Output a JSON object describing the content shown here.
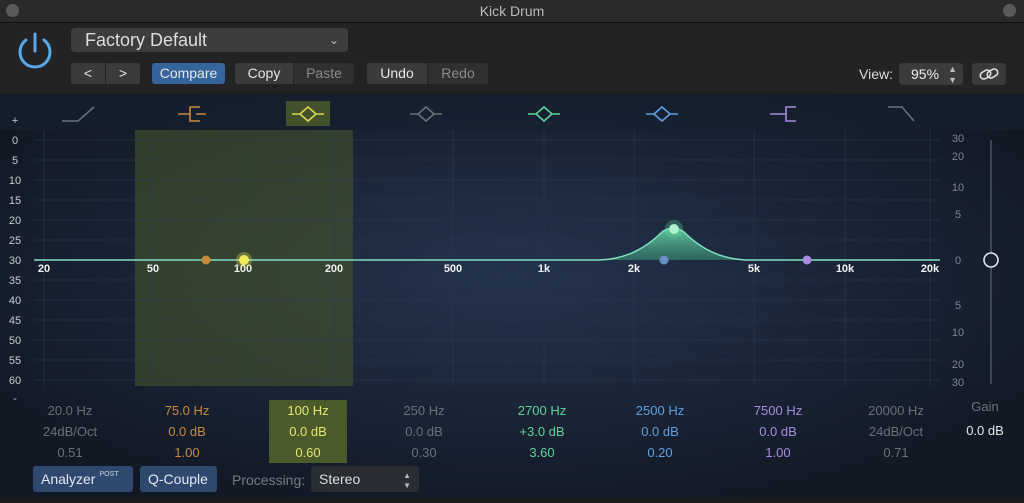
{
  "window": {
    "title": "Kick Drum"
  },
  "header": {
    "preset": "Factory Default",
    "nav_prev": "<",
    "nav_next": ">",
    "compare": "Compare",
    "copy": "Copy",
    "paste": "Paste",
    "undo": "Undo",
    "redo": "Redo",
    "view_label": "View:",
    "view_value": "95%"
  },
  "scales": {
    "left": [
      "+",
      "0",
      "5",
      "10",
      "15",
      "20",
      "25",
      "30",
      "35",
      "40",
      "45",
      "50",
      "55",
      "60",
      "-"
    ],
    "right": [
      "30",
      "20",
      "10",
      "5",
      "0",
      "5",
      "10",
      "20",
      "30"
    ]
  },
  "freq_labels": [
    "20",
    "50",
    "100",
    "200",
    "500",
    "1k",
    "2k",
    "5k",
    "10k",
    "20k"
  ],
  "bands": [
    {
      "freq": "20.0 Hz",
      "gain": "24dB/Oct",
      "q": "0.51",
      "color": "#6a7078",
      "active": false
    },
    {
      "freq": "75.0 Hz",
      "gain": "0.0 dB",
      "q": "1.00",
      "color": "#c8893e",
      "active": true
    },
    {
      "freq": "100 Hz",
      "gain": "0.0 dB",
      "q": "0.60",
      "color": "#d8d450",
      "active": true,
      "selected": true
    },
    {
      "freq": "250 Hz",
      "gain": "0.0 dB",
      "q": "0.30",
      "color": "#6a7078",
      "active": false
    },
    {
      "freq": "2700 Hz",
      "gain": "+3.0 dB",
      "q": "3.60",
      "color": "#5fd39a",
      "active": true
    },
    {
      "freq": "2500 Hz",
      "gain": "0.0 dB",
      "q": "0.20",
      "color": "#5f9fe0",
      "active": true
    },
    {
      "freq": "7500 Hz",
      "gain": "0.0 dB",
      "q": "1.00",
      "color": "#a78be0",
      "active": true
    },
    {
      "freq": "20000 Hz",
      "gain": "24dB/Oct",
      "q": "0.71",
      "color": "#6a7078",
      "active": false
    }
  ],
  "gain": {
    "label": "Gain",
    "value": "0.0 dB"
  },
  "bottom": {
    "analyzer": "Analyzer",
    "post": "POST",
    "q_couple": "Q-Couple",
    "processing_label": "Processing:",
    "processing_value": "Stereo"
  }
}
